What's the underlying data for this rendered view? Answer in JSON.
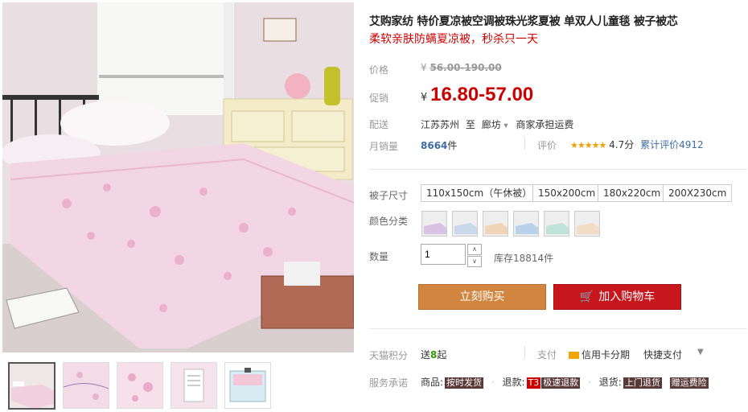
{
  "product": {
    "title": "艾购家纺 特价夏凉被空调被珠光浆夏被 单双人儿童毯 被子被芯",
    "subtitle": "柔软亲肤防螨夏凉被，秒杀只一天"
  },
  "price": {
    "label": "价格",
    "currency": "¥",
    "original": "56.00-190.00",
    "promo_label": "促销",
    "promo": "16.80-57.00"
  },
  "shipping": {
    "label": "配送",
    "from": "江苏苏州",
    "to_word": "至",
    "to": "廊坊",
    "note": "商家承担运费"
  },
  "sales": {
    "label": "月销量",
    "count": "8664",
    "unit": "件",
    "rating_label": "评价",
    "stars": "★★★★★",
    "score": "4.7分",
    "reviews": "累计评价4912"
  },
  "size": {
    "label": "被子尺寸",
    "options": [
      "110x150cm（午休被）",
      "150x200cm",
      "180x220cm",
      "200X230cm"
    ]
  },
  "color": {
    "label": "颜色分类"
  },
  "quantity": {
    "label": "数量",
    "value": "1",
    "stock": "库存18814件"
  },
  "buttons": {
    "buy": "立刻购买",
    "cart": "加入购物车"
  },
  "points": {
    "label": "天猫积分",
    "text_pre": "送",
    "amount": "8",
    "text_post": "起",
    "pay_label": "支付",
    "credit": "信用卡分期",
    "quick": "快捷支付"
  },
  "service": {
    "label": "服务承诺",
    "goods": "商品:",
    "goods_badge": "按时发货",
    "refund": "退款:",
    "refund_t3": "T3",
    "refund_badge": "极速退款",
    "return": "退货:",
    "return_badge": "上门退货",
    "insurance": "赠运费险"
  },
  "colors": {
    "promo_red": "#cc0000",
    "buy_btn": "#d1853e",
    "cart_btn": "#c8161d",
    "points_green": "#339900",
    "sales_blue": "#3f6ca5"
  }
}
